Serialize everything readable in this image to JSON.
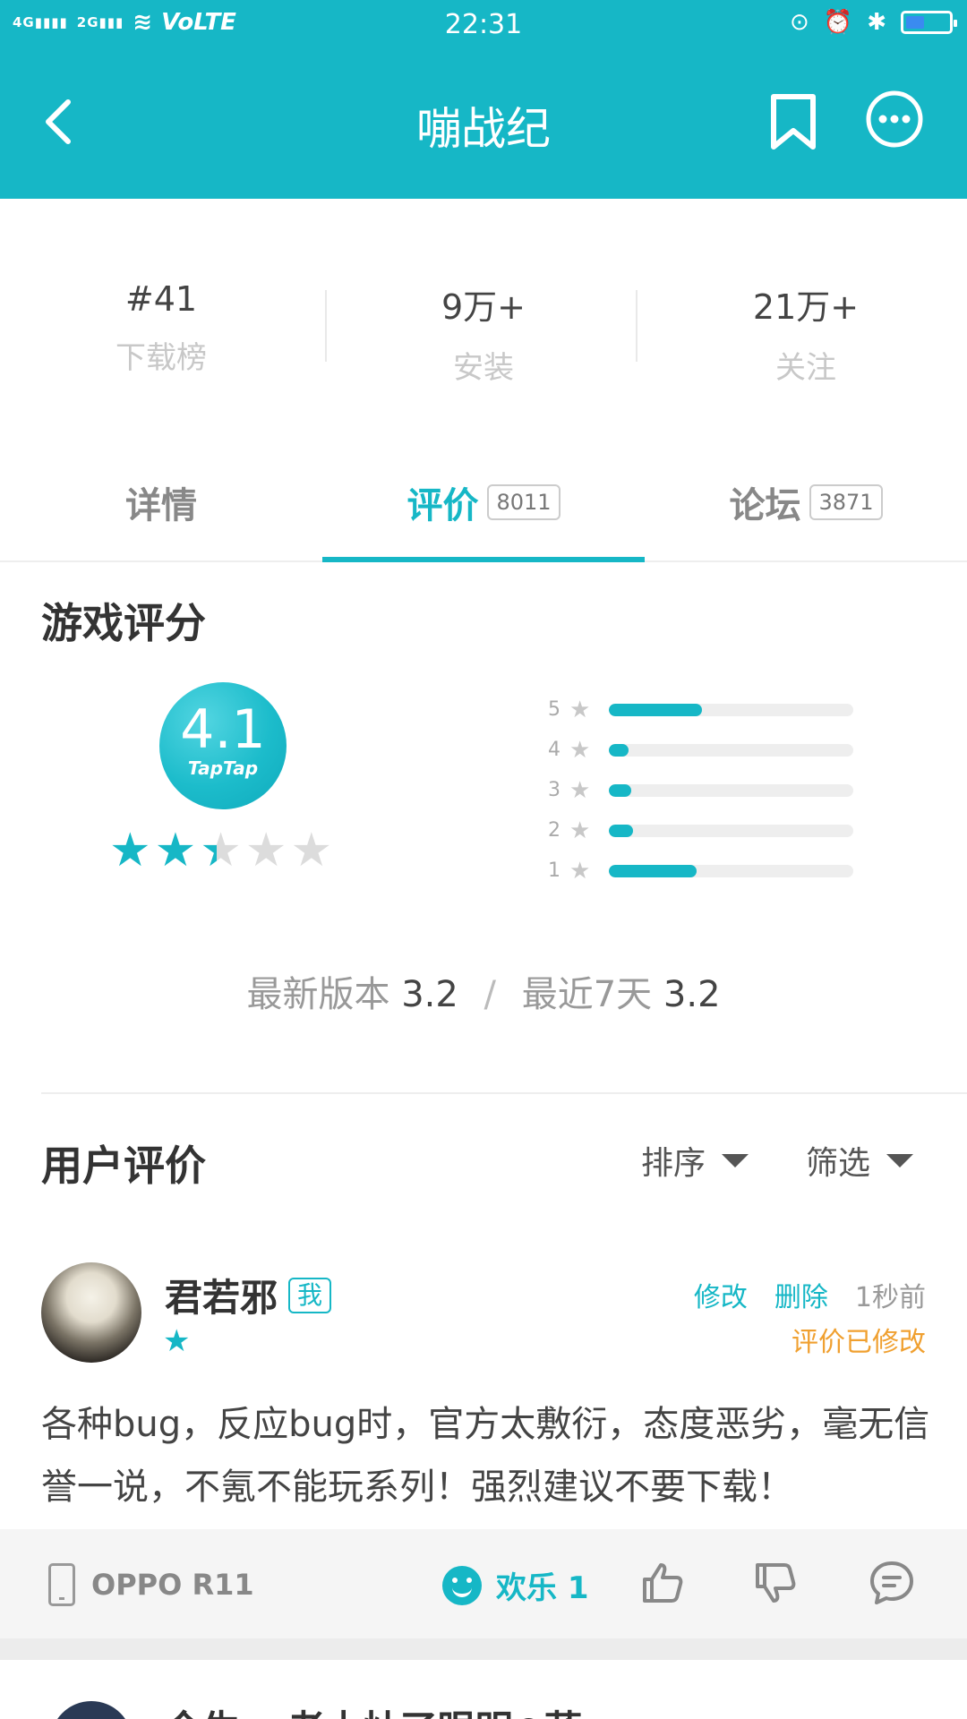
{
  "status_bar": {
    "network_left": "4G",
    "network_right": "2G",
    "volte": "VoLTE",
    "time": "22:31"
  },
  "header": {
    "title": "嘣战纪"
  },
  "stats": [
    {
      "value": "#41",
      "label": "下载榜"
    },
    {
      "value": "9万+",
      "label": "安装"
    },
    {
      "value": "21万+",
      "label": "关注"
    }
  ],
  "tabs": [
    {
      "label": "详情",
      "count": ""
    },
    {
      "label": "评价",
      "count": "8011"
    },
    {
      "label": "论坛",
      "count": "3871"
    }
  ],
  "game_rating": {
    "title": "游戏评分",
    "score": "4.1",
    "brand": "TapTap",
    "star_fill": 2.4,
    "distribution": [
      {
        "star": "5",
        "fraction": 0.38
      },
      {
        "star": "4",
        "fraction": 0.08
      },
      {
        "star": "3",
        "fraction": 0.09
      },
      {
        "star": "2",
        "fraction": 0.1
      },
      {
        "star": "1",
        "fraction": 0.36
      }
    ],
    "latest_label": "最新版本",
    "latest_value": "3.2",
    "separator": "/",
    "recent_label": "最近7天",
    "recent_value": "3.2"
  },
  "user_reviews": {
    "title": "用户评价",
    "sort_label": "排序",
    "filter_label": "筛选"
  },
  "review": {
    "username": "君若邪",
    "me_tag": "我",
    "edit": "修改",
    "delete": "删除",
    "time": "1秒前",
    "modified": "评价已修改",
    "text": "各种bug，反应bug时，官方太敷衍，态度恶劣，毫无信誉一说，不氪不能玩系列！强烈建议不要下载！",
    "device": "OPPO R11",
    "joy": "欢乐 1"
  },
  "next_review": {
    "username_partial": "今生za老土灶了眼明⊙萨"
  },
  "colors": {
    "accent": "#16b7c6",
    "modified": "#f0a030"
  }
}
